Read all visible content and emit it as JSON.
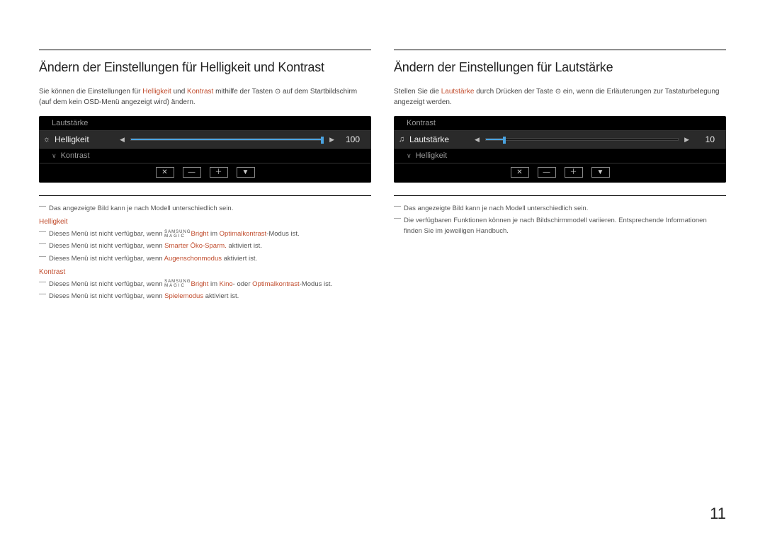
{
  "page_number": "11",
  "left": {
    "title": "Ändern der Einstellungen für Helligkeit und Kontrast",
    "intro_1": "Sie können die Einstellungen für ",
    "intro_h": "Helligkeit",
    "intro_2": " und ",
    "intro_k": "Kontrast",
    "intro_3": " mithilfe der Tasten ",
    "intro_icon": "⊙",
    "intro_4": " auf dem Startbildschirm (auf dem kein OSD-Menü angezeigt wird) ändern.",
    "osd": {
      "above": "Lautstärke",
      "label": "Helligkeit",
      "value": "100",
      "fill_pct": 100,
      "below": "Kontrast"
    },
    "note_model": "Das angezeigte Bild kann je nach Modell unterschiedlich sein.",
    "head_h": "Helligkeit",
    "h_notes": [
      {
        "pre": "Dieses Menü ist nicht verfügbar, wenn ",
        "magic": true,
        "mid": "Bright",
        "mid2": " im ",
        "acc": "Optimalkontrast",
        "post": "-Modus ist."
      },
      {
        "pre": "Dieses Menü ist nicht verfügbar, wenn ",
        "acc": "Smarter Öko-Sparm.",
        "post": " aktiviert ist."
      },
      {
        "pre": "Dieses Menü ist nicht verfügbar, wenn ",
        "acc": "Augenschonmodus",
        "post": " aktiviert ist."
      }
    ],
    "head_k": "Kontrast",
    "k_notes": [
      {
        "pre": "Dieses Menü ist nicht verfügbar, wenn ",
        "magic": true,
        "mid": "Bright",
        "mid2": " im ",
        "acc": "Kino",
        "acc_sep": "- oder ",
        "acc2": "Optimalkontrast",
        "post": "-Modus ist."
      },
      {
        "pre": "Dieses Menü ist nicht verfügbar, wenn ",
        "acc": "Spielemodus",
        "post": " aktiviert ist."
      }
    ]
  },
  "right": {
    "title": "Ändern der Einstellungen für Lautstärke",
    "intro_1": "Stellen Sie die ",
    "intro_l": "Lautstärke",
    "intro_2": " durch Drücken der Taste ",
    "intro_icon": "⊙",
    "intro_3": " ein, wenn die Erläuterungen zur Tastaturbelegung angezeigt werden.",
    "osd": {
      "above": "Kontrast",
      "label": "Lautstärke",
      "value": "10",
      "fill_pct": 10,
      "below": "Helligkeit"
    },
    "note_model": "Das angezeigte Bild kann je nach Modell unterschiedlich sein.",
    "note_func": "Die verfügbaren Funktionen können je nach Bildschirmmodell variieren. Entsprechende Informationen finden Sie im jeweiligen Handbuch."
  },
  "buttons": {
    "close": "✕",
    "minus": "—",
    "plus": "＋",
    "down": "▼"
  }
}
